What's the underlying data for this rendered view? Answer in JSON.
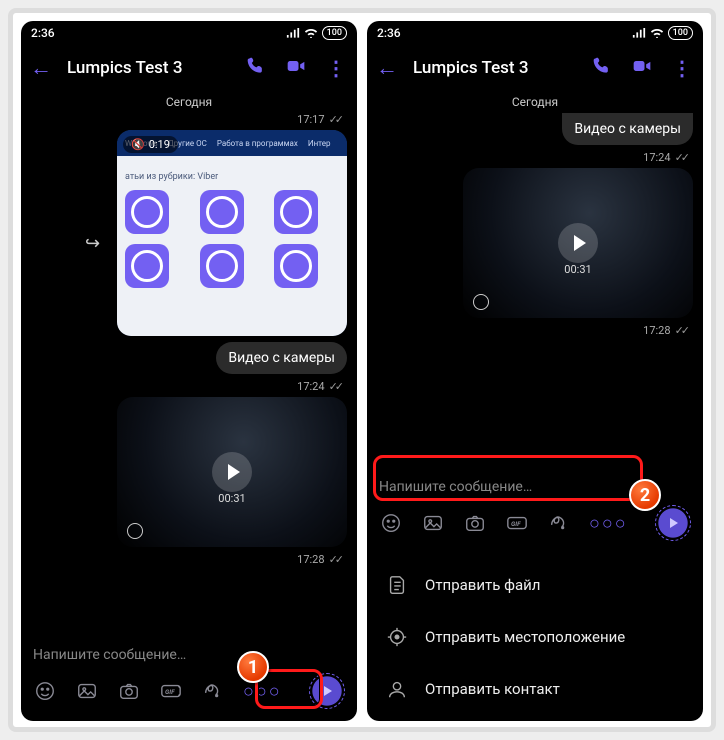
{
  "status": {
    "time": "2:36",
    "battery": "100"
  },
  "header": {
    "title": "Lumpics Test 3"
  },
  "chat": {
    "date_label": "Сегодня",
    "msg1": {
      "time": "17:17",
      "duration": "0:19",
      "tabs": [
        "Windows",
        "Другие ОС",
        "Работа в программах",
        "Интер"
      ],
      "rubric": "атьи из рубрики: Viber"
    },
    "msg2": {
      "text": "Видео с камеры",
      "time": "17:24"
    },
    "msg3": {
      "duration": "00:31",
      "time": "17:28"
    }
  },
  "input": {
    "placeholder": "Напишите сообщение…"
  },
  "attach_menu": {
    "file": "Отправить файл",
    "location": "Отправить местоположение",
    "contact": "Отправить контакт"
  },
  "callouts": {
    "one": "1",
    "two": "2"
  }
}
